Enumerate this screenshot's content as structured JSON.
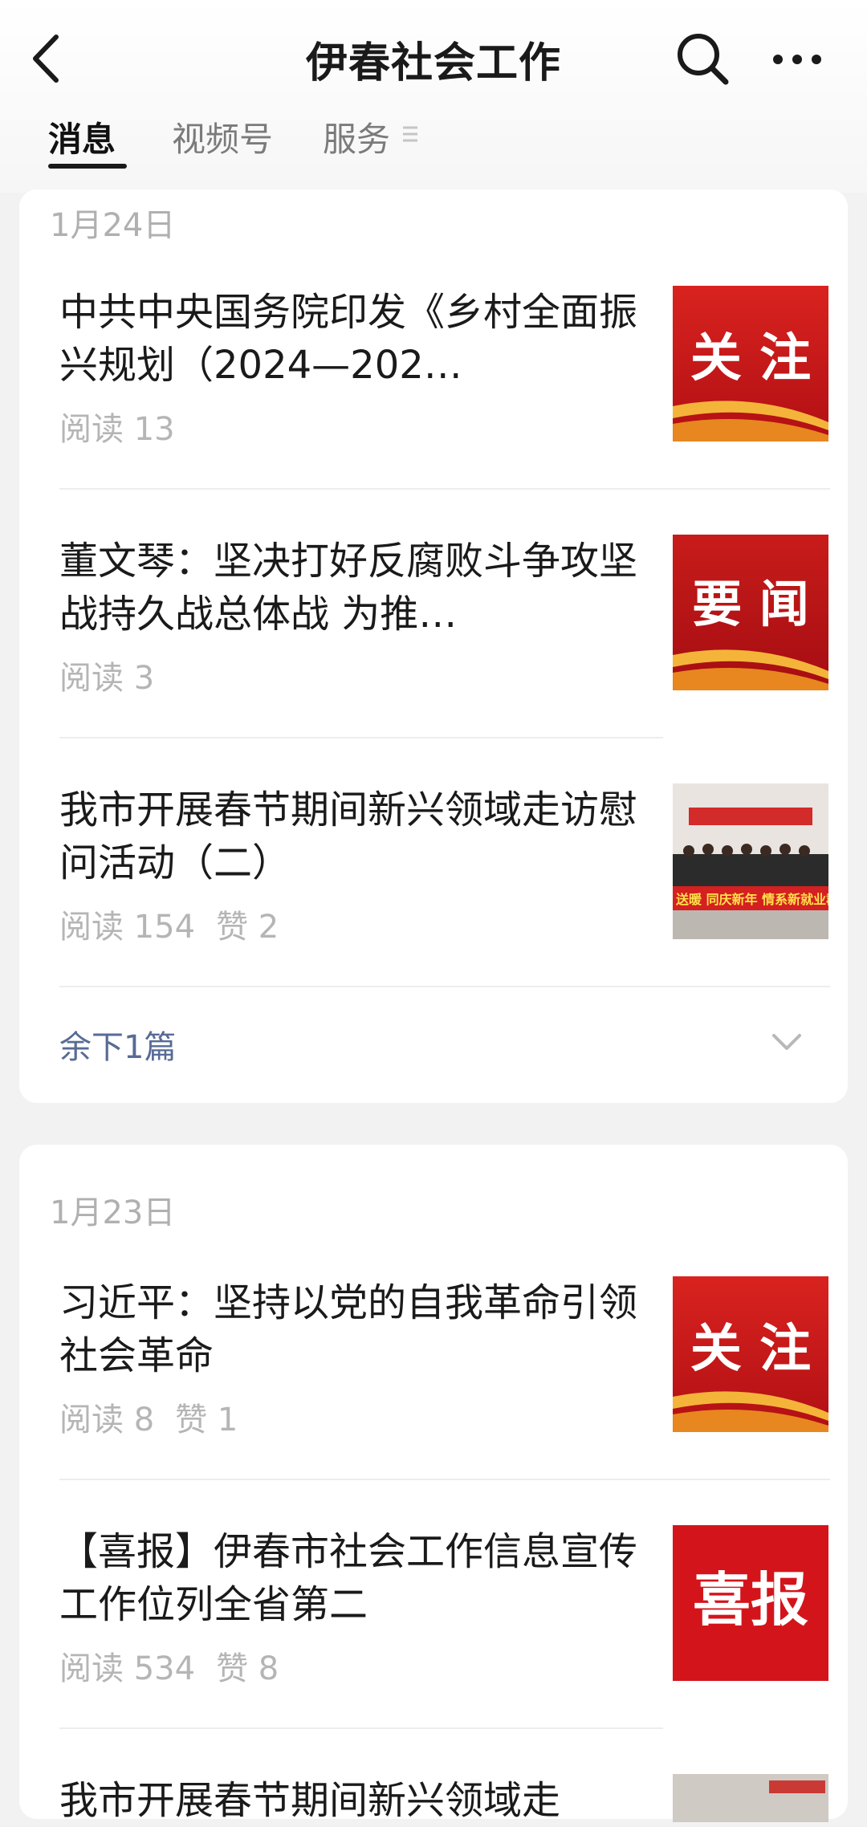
{
  "header": {
    "title": "伊春社会工作",
    "icons": [
      "back-icon",
      "search-icon",
      "more-icon"
    ]
  },
  "tabs": [
    {
      "label": "消息",
      "active": true
    },
    {
      "label": "视频号",
      "active": false
    },
    {
      "label": "服务",
      "active": false
    }
  ],
  "groups": [
    {
      "date": "1月24日",
      "articles": [
        {
          "title": "中共中央国务院印发《乡村全面振兴规划（2024—202…",
          "read": "阅读 13",
          "likes": "",
          "thumb_text": "关 注"
        },
        {
          "title": "董文琴：坚决打好反腐败斗争攻坚战持久战总体战 为推…",
          "read": "阅读 3",
          "likes": "",
          "thumb_text": "要 闻"
        },
        {
          "title": "我市开展春节期间新兴领域走访慰问活动（二）",
          "read": "阅读 154",
          "likes": "赞 2",
          "thumb_text": "送暖 同庆新年 情系新就业群"
        }
      ],
      "more_label": "余下1篇"
    },
    {
      "date": "1月23日",
      "articles": [
        {
          "title": "习近平：坚持以党的自我革命引领社会革命",
          "read": "阅读 8",
          "likes": "赞 1",
          "thumb_text": "关 注"
        },
        {
          "title": "【喜报】伊春市社会工作信息宣传工作位列全省第二",
          "read": "阅读 534",
          "likes": "赞 8",
          "thumb_text": "喜报"
        },
        {
          "title": "我市开展春节期间新兴领域走",
          "read": "",
          "likes": "",
          "thumb_text": ""
        }
      ]
    }
  ],
  "colors": {
    "accent_link": "#576b95",
    "thumb_red": "#c8141a"
  }
}
